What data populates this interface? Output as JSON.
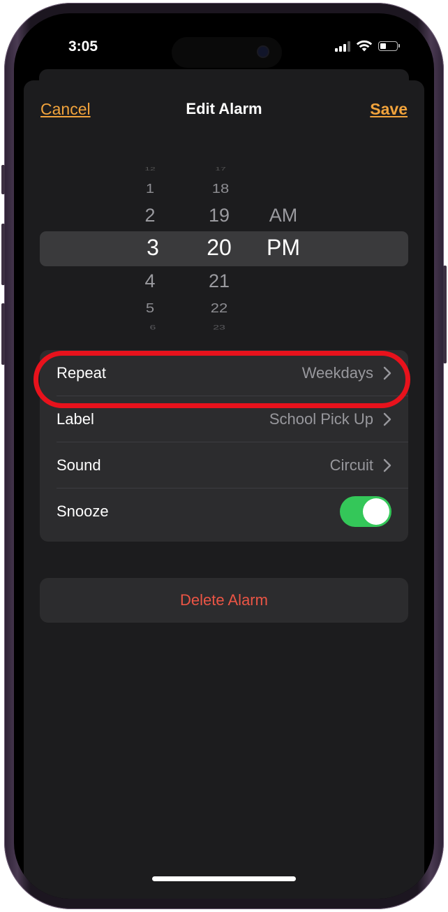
{
  "status_bar": {
    "time": "3:05",
    "battery_level": 0.4
  },
  "nav": {
    "cancel_label": "Cancel",
    "title": "Edit Alarm",
    "save_label": "Save"
  },
  "picker": {
    "hours": [
      "12",
      "1",
      "2",
      "3",
      "4",
      "5",
      "6"
    ],
    "minutes": [
      "17",
      "18",
      "19",
      "20",
      "21",
      "22",
      "23"
    ],
    "periods": [
      "AM",
      "PM"
    ],
    "selected": {
      "hour": "3",
      "minute": "20",
      "period": "PM"
    }
  },
  "settings": {
    "repeat": {
      "label": "Repeat",
      "value": "Weekdays"
    },
    "label": {
      "label": "Label",
      "value": "School Pick Up"
    },
    "sound": {
      "label": "Sound",
      "value": "Circuit"
    },
    "snooze": {
      "label": "Snooze",
      "on": true
    }
  },
  "delete_label": "Delete Alarm",
  "colors": {
    "accent": "#f1a33c",
    "destructive": "#eb5545",
    "toggle_on": "#34c759",
    "highlight": "#e8121c"
  }
}
